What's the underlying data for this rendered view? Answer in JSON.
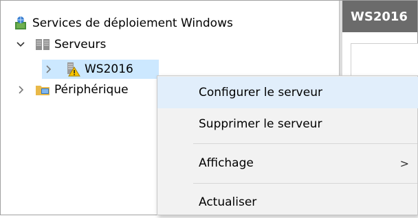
{
  "tree": {
    "root_label": "Services de déploiement Windows",
    "servers_label": "Serveurs",
    "server_label": "WS2016",
    "devices_label": "Périphérique"
  },
  "right_pane": {
    "tab_title": "WS2016"
  },
  "context_menu": {
    "items": [
      {
        "label": "Configurer le serveur"
      },
      {
        "label": "Supprimer le serveur"
      },
      {
        "label": "Affichage",
        "submenu_arrow": ">"
      },
      {
        "label": "Actualiser"
      }
    ]
  },
  "colors": {
    "selection": "#cce8ff",
    "menu_bg": "#f2f2f2",
    "menu_hover": "#e1eefb",
    "tab_header": "#6b6b6b"
  }
}
